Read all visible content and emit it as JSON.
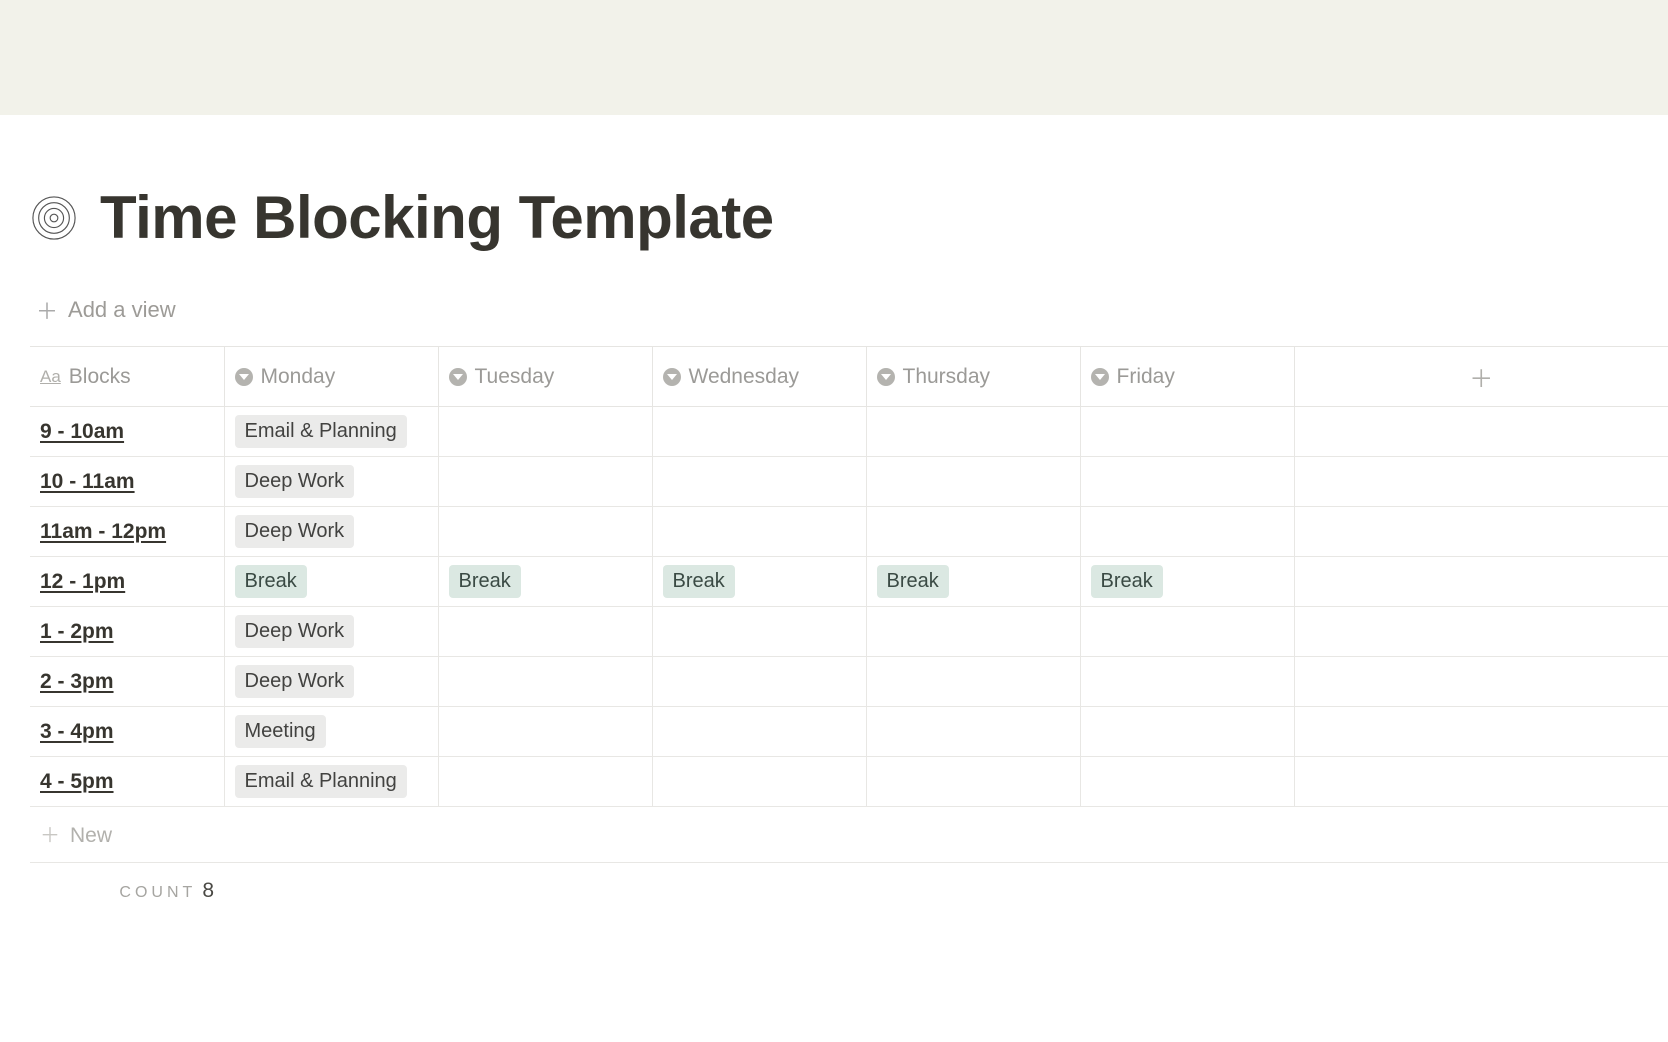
{
  "page": {
    "title": "Time Blocking Template",
    "add_view_label": "Add a view",
    "new_row_label": "New",
    "count_label": "count",
    "count_value": "8"
  },
  "columns": {
    "blocks": "Blocks",
    "days": [
      "Monday",
      "Tuesday",
      "Wednesday",
      "Thursday",
      "Friday"
    ]
  },
  "tags": {
    "email_planning": {
      "text": "Email & Planning",
      "style": "gray"
    },
    "deep_work": {
      "text": "Deep Work",
      "style": "gray"
    },
    "break": {
      "text": "Break",
      "style": "green"
    },
    "meeting": {
      "text": "Meeting",
      "style": "gray"
    }
  },
  "rows": [
    {
      "block": "9 - 10am",
      "cells": [
        "email_planning",
        "",
        "",
        "",
        ""
      ]
    },
    {
      "block": "10 - 11am",
      "cells": [
        "deep_work",
        "",
        "",
        "",
        ""
      ]
    },
    {
      "block": "11am - 12pm",
      "cells": [
        "deep_work",
        "",
        "",
        "",
        ""
      ]
    },
    {
      "block": "12 - 1pm",
      "cells": [
        "break",
        "break",
        "break",
        "break",
        "break"
      ]
    },
    {
      "block": "1 - 2pm",
      "cells": [
        "deep_work",
        "",
        "",
        "",
        ""
      ]
    },
    {
      "block": "2 - 3pm",
      "cells": [
        "deep_work",
        "",
        "",
        "",
        ""
      ]
    },
    {
      "block": "3 - 4pm",
      "cells": [
        "meeting",
        "",
        "",
        "",
        ""
      ]
    },
    {
      "block": "4 - 5pm",
      "cells": [
        "email_planning",
        "",
        "",
        "",
        ""
      ]
    }
  ]
}
